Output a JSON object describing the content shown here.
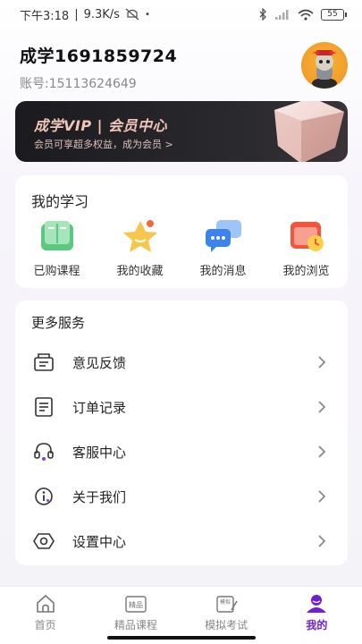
{
  "status": {
    "time": "下午3:18",
    "speed": "9.3K/s",
    "battery": "55"
  },
  "profile": {
    "name": "成学1691859724",
    "account": "账号:15113624649"
  },
  "vip": {
    "title": "成学VIP | 会员中心",
    "subtitle": "会员可享超多权益，成为会员 >"
  },
  "study": {
    "title": "我的学习",
    "items": [
      {
        "label": "已购课程",
        "icon": "book-icon"
      },
      {
        "label": "我的收藏",
        "icon": "star-icon"
      },
      {
        "label": "我的消息",
        "icon": "message-icon"
      },
      {
        "label": "我的浏览",
        "icon": "history-icon"
      }
    ]
  },
  "services": {
    "title": "更多服务",
    "items": [
      {
        "label": "意见反馈",
        "icon": "feedback-icon"
      },
      {
        "label": "订单记录",
        "icon": "order-icon"
      },
      {
        "label": "客服中心",
        "icon": "headset-icon"
      },
      {
        "label": "关于我们",
        "icon": "info-icon"
      },
      {
        "label": "设置中心",
        "icon": "settings-icon"
      }
    ]
  },
  "tabs": [
    {
      "label": "首页",
      "icon": "home-icon"
    },
    {
      "label": "精品课程",
      "icon": "courses-icon",
      "icon_text": "精品"
    },
    {
      "label": "模拟考试",
      "icon": "exam-icon",
      "icon_text": "模拟"
    },
    {
      "label": "我的",
      "icon": "profile-icon",
      "active": true
    }
  ],
  "colors": {
    "accent": "#6f1fd3",
    "vip_bg": "#1b1b1f",
    "vip_text": "#f1c6b9"
  }
}
